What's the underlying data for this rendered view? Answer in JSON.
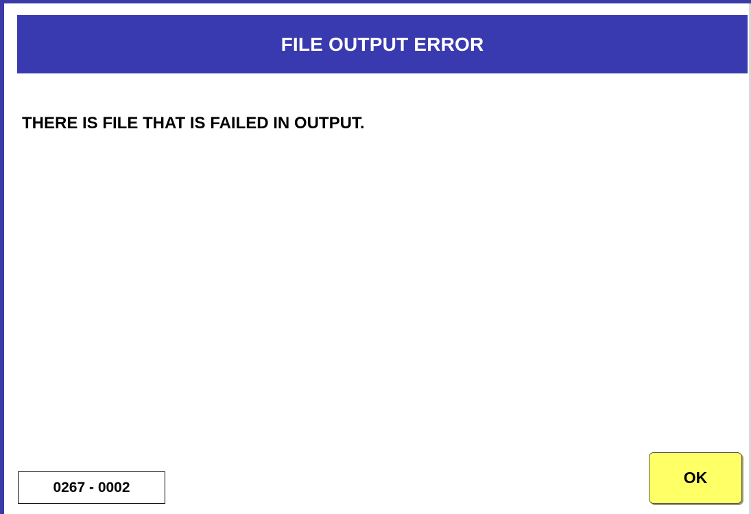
{
  "dialog": {
    "title": "FILE OUTPUT ERROR",
    "message": "THERE IS FILE THAT IS FAILED IN OUTPUT.",
    "error_code": "0267 - 0002",
    "ok_label": "OK"
  },
  "colors": {
    "title_bar": "#3a3ab0",
    "frame": "#3a3aa8",
    "ok_button": "#ffff66",
    "background": "#ffffff"
  }
}
